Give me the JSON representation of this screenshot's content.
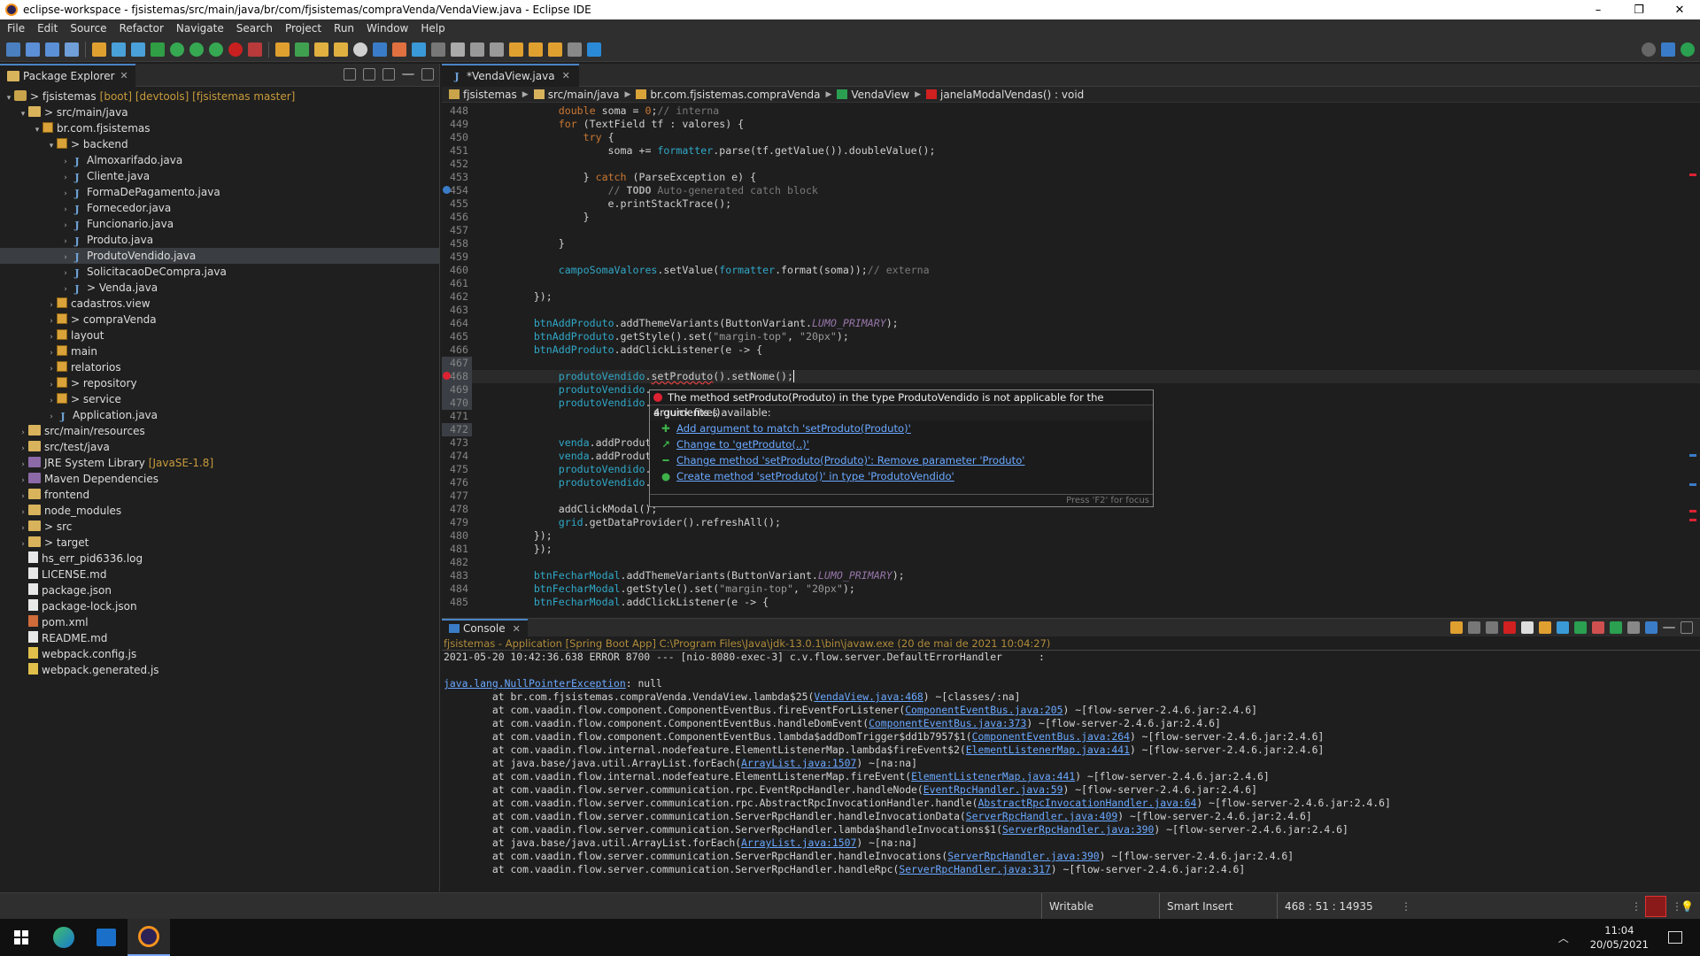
{
  "window": {
    "title": "eclipse-workspace - fjsistemas/src/main/java/br/com/fjsistemas/compraVenda/VendaView.java - Eclipse IDE",
    "minimize": "–",
    "maximize": "❐",
    "close": "✕"
  },
  "menu": [
    "File",
    "Edit",
    "Source",
    "Refactor",
    "Navigate",
    "Search",
    "Project",
    "Run",
    "Window",
    "Help"
  ],
  "package_explorer": {
    "tab_label": "Package Explorer",
    "items": [
      {
        "indent": 0,
        "arrow": "▾",
        "icon": "project",
        "label": "> fjsistemas",
        "extra": "[boot] [devtools] [fjsistemas master]"
      },
      {
        "indent": 1,
        "arrow": "▾",
        "icon": "folder",
        "label": "> src/main/java",
        "extra": ""
      },
      {
        "indent": 2,
        "arrow": "▾",
        "icon": "package",
        "label": "br.com.fjsistemas",
        "extra": ""
      },
      {
        "indent": 3,
        "arrow": "▾",
        "icon": "package",
        "label": "> backend",
        "extra": ""
      },
      {
        "indent": 4,
        "arrow": "›",
        "icon": "java",
        "label": "Almoxarifado.java",
        "extra": ""
      },
      {
        "indent": 4,
        "arrow": "›",
        "icon": "java",
        "label": "Cliente.java",
        "extra": ""
      },
      {
        "indent": 4,
        "arrow": "›",
        "icon": "java",
        "label": "FormaDePagamento.java",
        "extra": ""
      },
      {
        "indent": 4,
        "arrow": "›",
        "icon": "java",
        "label": "Fornecedor.java",
        "extra": ""
      },
      {
        "indent": 4,
        "arrow": "›",
        "icon": "java",
        "label": "Funcionario.java",
        "extra": ""
      },
      {
        "indent": 4,
        "arrow": "›",
        "icon": "java",
        "label": "Produto.java",
        "extra": ""
      },
      {
        "indent": 4,
        "arrow": "›",
        "icon": "java",
        "label": "ProdutoVendido.java",
        "extra": "",
        "selected": true
      },
      {
        "indent": 4,
        "arrow": "›",
        "icon": "java",
        "label": "SolicitacaoDeCompra.java",
        "extra": ""
      },
      {
        "indent": 4,
        "arrow": "›",
        "icon": "java",
        "label": "> Venda.java",
        "extra": ""
      },
      {
        "indent": 3,
        "arrow": "›",
        "icon": "package",
        "label": "cadastros.view",
        "extra": ""
      },
      {
        "indent": 3,
        "arrow": "›",
        "icon": "package",
        "label": "> compraVenda",
        "extra": ""
      },
      {
        "indent": 3,
        "arrow": "›",
        "icon": "package",
        "label": "layout",
        "extra": ""
      },
      {
        "indent": 3,
        "arrow": "›",
        "icon": "package",
        "label": "main",
        "extra": ""
      },
      {
        "indent": 3,
        "arrow": "›",
        "icon": "package",
        "label": "relatorios",
        "extra": ""
      },
      {
        "indent": 3,
        "arrow": "›",
        "icon": "package",
        "label": "> repository",
        "extra": ""
      },
      {
        "indent": 3,
        "arrow": "›",
        "icon": "package",
        "label": "> service",
        "extra": ""
      },
      {
        "indent": 3,
        "arrow": "›",
        "icon": "java",
        "label": "Application.java",
        "extra": ""
      },
      {
        "indent": 1,
        "arrow": "›",
        "icon": "folder",
        "label": "src/main/resources",
        "extra": ""
      },
      {
        "indent": 1,
        "arrow": "›",
        "icon": "folder",
        "label": "src/test/java",
        "extra": ""
      },
      {
        "indent": 1,
        "arrow": "›",
        "icon": "lib",
        "label": "JRE System Library",
        "extra": "[JavaSE-1.8]"
      },
      {
        "indent": 1,
        "arrow": "›",
        "icon": "lib",
        "label": "Maven Dependencies",
        "extra": ""
      },
      {
        "indent": 1,
        "arrow": "›",
        "icon": "folder",
        "label": "frontend",
        "extra": ""
      },
      {
        "indent": 1,
        "arrow": "›",
        "icon": "folder",
        "label": "node_modules",
        "extra": ""
      },
      {
        "indent": 1,
        "arrow": "›",
        "icon": "folder",
        "label": "> src",
        "extra": ""
      },
      {
        "indent": 1,
        "arrow": "›",
        "icon": "folder",
        "label": "> target",
        "extra": ""
      },
      {
        "indent": 1,
        "arrow": "",
        "icon": "file",
        "label": "hs_err_pid6336.log",
        "extra": ""
      },
      {
        "indent": 1,
        "arrow": "",
        "icon": "file",
        "label": "LICENSE.md",
        "extra": ""
      },
      {
        "indent": 1,
        "arrow": "",
        "icon": "file",
        "label": "package.json",
        "extra": ""
      },
      {
        "indent": 1,
        "arrow": "",
        "icon": "file",
        "label": "package-lock.json",
        "extra": ""
      },
      {
        "indent": 1,
        "arrow": "",
        "icon": "xml",
        "label": "pom.xml",
        "extra": ""
      },
      {
        "indent": 1,
        "arrow": "",
        "icon": "file",
        "label": "README.md",
        "extra": ""
      },
      {
        "indent": 1,
        "arrow": "",
        "icon": "js",
        "label": "webpack.config.js",
        "extra": ""
      },
      {
        "indent": 1,
        "arrow": "",
        "icon": "js",
        "label": "webpack.generated.js",
        "extra": ""
      }
    ]
  },
  "editor": {
    "tab_label": "*VendaView.java",
    "breadcrumbs": [
      "fjsistemas",
      "src/main/java",
      "br.com.fjsistemas.compraVenda",
      "VendaView",
      "janelaModalVendas() : void"
    ],
    "lines": [
      {
        "n": "448",
        "html": "            <span class='kw'>double</span> soma = <span class='kw'>0</span>;<span class='cm'>// interna</span>"
      },
      {
        "n": "449",
        "html": "            <span class='kw'>for</span> (TextField tf : valores) {"
      },
      {
        "n": "450",
        "html": "                <span class='kw'>try</span> {"
      },
      {
        "n": "451",
        "html": "                    soma += <span class='cyan'>formatter</span>.parse(tf.getValue()).doubleValue();"
      },
      {
        "n": "452",
        "html": ""
      },
      {
        "n": "453",
        "html": "                } <span class='kw'>catch</span> (ParseException e) {"
      },
      {
        "n": "454",
        "html": "                    <span class='cm'>// <b style='color:#a7a7a7'>TODO</b> Auto-generated catch block</span>",
        "mark": "task"
      },
      {
        "n": "455",
        "html": "                    e.printStackTrace();"
      },
      {
        "n": "456",
        "html": "                }"
      },
      {
        "n": "457",
        "html": ""
      },
      {
        "n": "458",
        "html": "            }"
      },
      {
        "n": "459",
        "html": ""
      },
      {
        "n": "460",
        "html": "            <span class='cyan'>campoSomaValores</span>.setValue(<span class='cyan'>formatter</span>.format(soma));<span class='cm'>// externa</span>"
      },
      {
        "n": "461",
        "html": ""
      },
      {
        "n": "462",
        "html": "        });"
      },
      {
        "n": "463",
        "html": ""
      },
      {
        "n": "464",
        "html": "        <span class='cyan'>btnAddProduto</span>.addThemeVariants(ButtonVariant.<span class='const'>LUMO_PRIMARY</span>);"
      },
      {
        "n": "465",
        "html": "        <span class='cyan'>btnAddProduto</span>.getStyle().set(<span class='str'>\"margin-top\"</span>, <span class='str'>\"20px\"</span>);"
      },
      {
        "n": "466",
        "html": "        <span class='cyan'>btnAddProduto</span>.addClickListener(e -&gt; {"
      },
      {
        "n": "467",
        "html": "",
        "hl": true
      },
      {
        "n": "468",
        "html": "            <span class='cyan'>produtoVendido</span>.<span style='text-decoration:underline wavy #e04040'>setProduto</span>().setNome();",
        "hl": true,
        "mark": "error",
        "cur": true
      },
      {
        "n": "469",
        "html": "            <span class='cyan'>produtoVendido</span>.",
        "hl": true
      },
      {
        "n": "470",
        "html": "            <span class='cyan'>produtoVendido</span>.",
        "hl": true
      },
      {
        "n": "471",
        "html": ""
      },
      {
        "n": "472",
        "html": "",
        "hl": true
      },
      {
        "n": "473",
        "html": "            <span class='cyan'>venda</span>.addProdut"
      },
      {
        "n": "474",
        "html": "            <span class='cyan'>venda</span>.addProdut"
      },
      {
        "n": "475",
        "html": "            <span class='cyan'>produtoVendido</span>."
      },
      {
        "n": "476",
        "html": "            <span class='cyan'>produtoVendido</span>."
      },
      {
        "n": "477",
        "html": ""
      },
      {
        "n": "478",
        "html": "            addClickModal();"
      },
      {
        "n": "479",
        "html": "            <span class='cyan'>grid</span>.getDataProvider().refreshAll();"
      },
      {
        "n": "480",
        "html": "        });"
      },
      {
        "n": "481",
        "html": "        });"
      },
      {
        "n": "482",
        "html": ""
      },
      {
        "n": "483",
        "html": "        <span class='cyan'>btnFecharModal</span>.addThemeVariants(ButtonVariant.<span class='const'>LUMO_PRIMARY</span>);"
      },
      {
        "n": "484",
        "html": "        <span class='cyan'>btnFecharModal</span>.getStyle().set(<span class='str'>\"margin-top\"</span>, <span class='str'>\"20px\"</span>);"
      },
      {
        "n": "485",
        "html": "        <span class='cyan'>btnFecharModal</span>.addClickListener(e -&gt; {"
      }
    ]
  },
  "quickfix": {
    "message": "The method setProduto(Produto) in the type ProdutoVendido is not applicable for the arguments ()",
    "count": "4 quick fixes available:",
    "fixes": [
      {
        "icon": "✚",
        "color": "#3db04a",
        "label": "Add argument to match 'setProduto(Produto)'"
      },
      {
        "icon": "↗",
        "color": "#3db04a",
        "label": "Change to 'getProduto(..)'"
      },
      {
        "icon": "━",
        "color": "#3db04a",
        "label": "Change method 'setProduto(Produto)': Remove parameter 'Produto'"
      },
      {
        "icon": "●",
        "color": "#3db04a",
        "label": "Create method 'setProduto()' in type 'ProdutoVendido'"
      }
    ],
    "footer": "Press 'F2' for focus"
  },
  "console": {
    "tab_label": "Console",
    "description": "fjsistemas - Application [Spring Boot App] C:\\Program Files\\Java\\jdk-13.0.1\\bin\\javaw.exe  (20 de mai de 2021 10:04:27)",
    "lines": [
      {
        "pre": "2021-05-20 10:42:36.638 ERROR 8700 --- [nio-8080-exec-3] c.v.flow.server.DefaultErrorHandler      :",
        "link": "",
        "post": ""
      },
      {
        "pre": "",
        "link": "",
        "post": ""
      },
      {
        "pre": "",
        "link": "java.lang.NullPointerException",
        "post": ": null"
      },
      {
        "pre": "\tat br.com.fjsistemas.compraVenda.VendaView.lambda$25(",
        "link": "VendaView.java:468",
        "post": ") ~[classes/:na]"
      },
      {
        "pre": "\tat com.vaadin.flow.component.ComponentEventBus.fireEventForListener(",
        "link": "ComponentEventBus.java:205",
        "post": ") ~[flow-server-2.4.6.jar:2.4.6]"
      },
      {
        "pre": "\tat com.vaadin.flow.component.ComponentEventBus.handleDomEvent(",
        "link": "ComponentEventBus.java:373",
        "post": ") ~[flow-server-2.4.6.jar:2.4.6]"
      },
      {
        "pre": "\tat com.vaadin.flow.component.ComponentEventBus.lambda$addDomTrigger$dd1b7957$1(",
        "link": "ComponentEventBus.java:264",
        "post": ") ~[flow-server-2.4.6.jar:2.4.6]"
      },
      {
        "pre": "\tat com.vaadin.flow.internal.nodefeature.ElementListenerMap.lambda$fireEvent$2(",
        "link": "ElementListenerMap.java:441",
        "post": ") ~[flow-server-2.4.6.jar:2.4.6]"
      },
      {
        "pre": "\tat java.base/java.util.ArrayList.forEach(",
        "link": "ArrayList.java:1507",
        "post": ") ~[na:na]"
      },
      {
        "pre": "\tat com.vaadin.flow.internal.nodefeature.ElementListenerMap.fireEvent(",
        "link": "ElementListenerMap.java:441",
        "post": ") ~[flow-server-2.4.6.jar:2.4.6]"
      },
      {
        "pre": "\tat com.vaadin.flow.server.communication.rpc.EventRpcHandler.handleNode(",
        "link": "EventRpcHandler.java:59",
        "post": ") ~[flow-server-2.4.6.jar:2.4.6]"
      },
      {
        "pre": "\tat com.vaadin.flow.server.communication.rpc.AbstractRpcInvocationHandler.handle(",
        "link": "AbstractRpcInvocationHandler.java:64",
        "post": ") ~[flow-server-2.4.6.jar:2.4.6]"
      },
      {
        "pre": "\tat com.vaadin.flow.server.communication.ServerRpcHandler.handleInvocationData(",
        "link": "ServerRpcHandler.java:409",
        "post": ") ~[flow-server-2.4.6.jar:2.4.6]"
      },
      {
        "pre": "\tat com.vaadin.flow.server.communication.ServerRpcHandler.lambda$handleInvocations$1(",
        "link": "ServerRpcHandler.java:390",
        "post": ") ~[flow-server-2.4.6.jar:2.4.6]"
      },
      {
        "pre": "\tat java.base/java.util.ArrayList.forEach(",
        "link": "ArrayList.java:1507",
        "post": ") ~[na:na]"
      },
      {
        "pre": "\tat com.vaadin.flow.server.communication.ServerRpcHandler.handleInvocations(",
        "link": "ServerRpcHandler.java:390",
        "post": ") ~[flow-server-2.4.6.jar:2.4.6]"
      },
      {
        "pre": "\tat com.vaadin.flow.server.communication.ServerRpcHandler.handleRpc(",
        "link": "ServerRpcHandler.java:317",
        "post": ") ~[flow-server-2.4.6.jar:2.4.6]"
      }
    ]
  },
  "status": {
    "writable": "Writable",
    "insert_mode": "Smart Insert",
    "position": "468 : 51 : 14935"
  },
  "taskbar": {
    "time": "11:04",
    "date": "20/05/2021"
  }
}
